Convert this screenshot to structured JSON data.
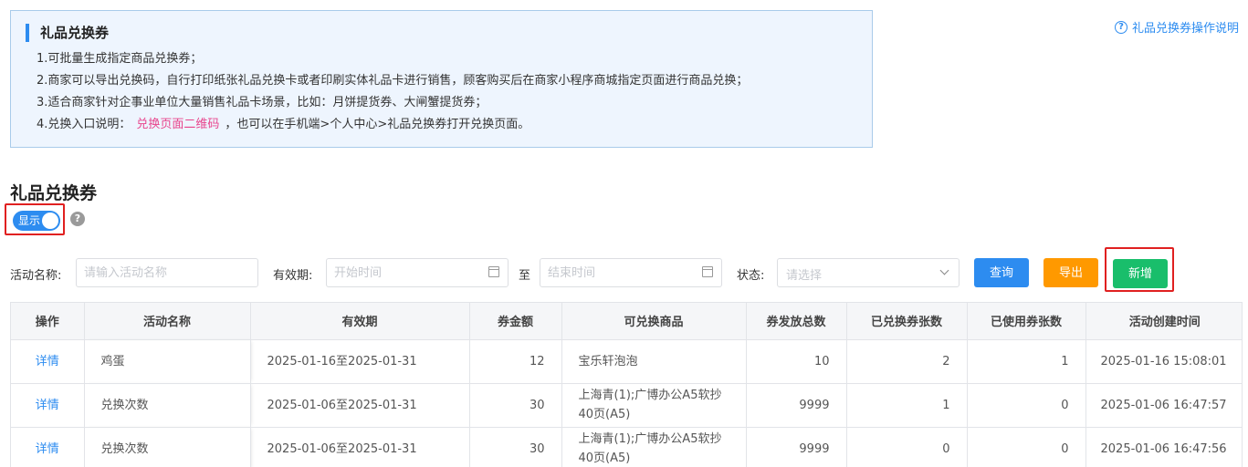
{
  "notice": {
    "title": "礼品兑换券",
    "line1": "1.可批量生成指定商品兑换券；",
    "line2": "2.商家可以导出兑换码，自行打印纸张礼品兑换卡或者印刷实体礼品卡进行销售，顾客购买后在商家小程序商城指定页面进行商品兑换；",
    "line3": "3.适合商家针对企事业单位大量销售礼品卡场景，比如：月饼提货券、大闸蟹提货券；",
    "line4_prefix": "4.兑换入口说明：",
    "line4_link": "兑换页面二维码",
    "line4_suffix": "，也可以在手机端>个人中心>礼品兑换券打开兑换页面。"
  },
  "help_link": "礼品兑换券操作说明",
  "section_title": "礼品兑换券",
  "toggle": {
    "label": "显示",
    "on": true
  },
  "filters": {
    "name_label": "活动名称:",
    "name_placeholder": "请输入活动名称",
    "validity_label": "有效期:",
    "start_placeholder": "开始时间",
    "to_label": "至",
    "end_placeholder": "结束时间",
    "status_label": "状态:",
    "status_placeholder": "请选择"
  },
  "buttons": {
    "query": "查询",
    "export": "导出",
    "add": "新增"
  },
  "table": {
    "headers": [
      "操作",
      "活动名称",
      "有效期",
      "券金额",
      "可兑换商品",
      "券发放总数",
      "已兑换券张数",
      "已使用券张数",
      "活动创建时间"
    ],
    "rows": [
      {
        "action": "详情",
        "name": "鸡蛋",
        "validity": "2025-01-16至2025-01-31",
        "amount": "12",
        "goods": "宝乐轩泡泡",
        "issued": "10",
        "redeemed": "2",
        "used": "1",
        "created": "2025-01-16 15:08:01"
      },
      {
        "action": "详情",
        "name": "兑换次数",
        "validity": "2025-01-06至2025-01-31",
        "amount": "30",
        "goods": "上海青(1);广博办公A5软抄40页(A5)",
        "issued": "9999",
        "redeemed": "1",
        "used": "0",
        "created": "2025-01-06 16:47:57"
      },
      {
        "action": "详情",
        "name": "兑换次数",
        "validity": "2025-01-06至2025-01-31",
        "amount": "30",
        "goods": "上海青(1);广博办公A5软抄40页(A5)",
        "issued": "9999",
        "redeemed": "0",
        "used": "0",
        "created": "2025-01-06 16:47:56"
      }
    ]
  },
  "colors": {
    "primary": "#2d8cf0",
    "warning": "#ff9900",
    "success": "#19be6b",
    "highlight": "#e02020",
    "pink": "#e8448c"
  }
}
